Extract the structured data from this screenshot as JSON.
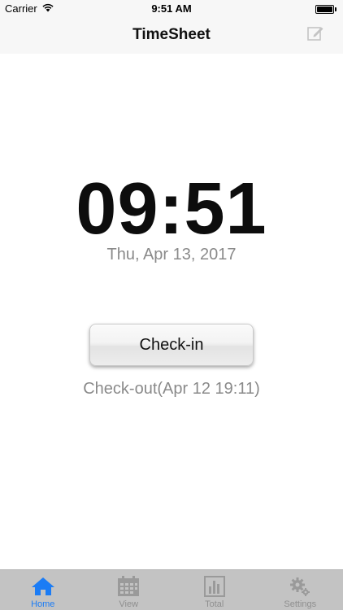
{
  "status_bar": {
    "carrier": "Carrier",
    "time": "9:51 AM"
  },
  "nav": {
    "title": "TimeSheet",
    "edit_icon": "edit-icon"
  },
  "clock": {
    "time": "09:51",
    "date": "Thu, Apr 13, 2017"
  },
  "actions": {
    "checkin_label": "Check-in",
    "last_checkout": "Check-out(Apr 12 19:11)"
  },
  "tabs": [
    {
      "label": "Home",
      "icon": "home-icon",
      "active": true
    },
    {
      "label": "View",
      "icon": "calendar-icon",
      "active": false
    },
    {
      "label": "Total",
      "icon": "bar-chart-icon",
      "active": false
    },
    {
      "label": "Settings",
      "icon": "gear-icon",
      "active": false
    }
  ],
  "colors": {
    "accent": "#1b7cf5",
    "inactive_tab": "#8f8f8f",
    "tab_bar_bg": "#c3c3c3",
    "secondary_text": "#8a8a8a"
  }
}
